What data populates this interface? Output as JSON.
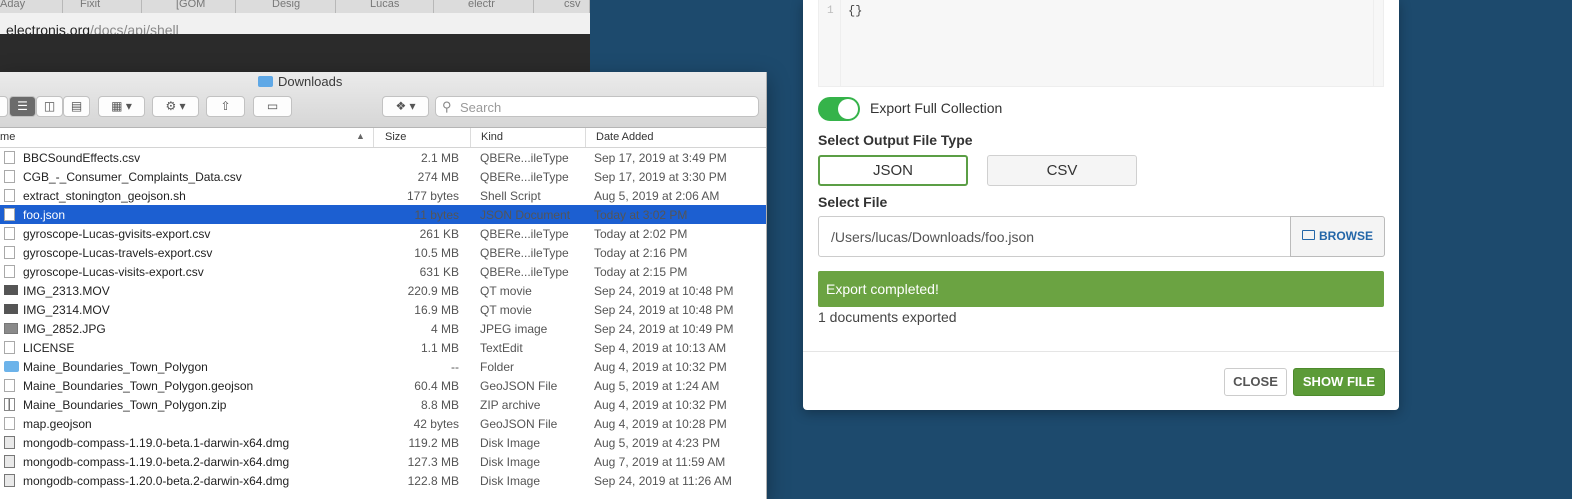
{
  "browser": {
    "tabs": [
      "Aday",
      "Fixit",
      "[GOM",
      "Desig",
      "Lucas",
      "electr",
      "csv"
    ],
    "url_host": "electronjs.org",
    "url_path": "/docs/api/shell"
  },
  "finder": {
    "title": "Downloads",
    "search_placeholder": "Search",
    "columns": {
      "name": "Name",
      "size": "Size",
      "kind": "Kind",
      "date": "Date Added"
    },
    "files": [
      {
        "icon": "document-icon",
        "name": "BBCSoundEffects.csv",
        "size": "2.1 MB",
        "kind": "QBERe...ileType",
        "date": "Sep 17, 2019 at 3:49 PM"
      },
      {
        "icon": "document-icon",
        "name": "CGB_-_Consumer_Complaints_Data.csv",
        "size": "274 MB",
        "kind": "QBERe...ileType",
        "date": "Sep 17, 2019 at 3:30 PM"
      },
      {
        "icon": "document-icon",
        "name": "extract_stonington_geojson.sh",
        "size": "177 bytes",
        "kind": "Shell Script",
        "date": "Aug 5, 2019 at 2:06 AM"
      },
      {
        "icon": "document-icon",
        "name": "foo.json",
        "size": "11 bytes",
        "kind": "JSON Document",
        "date": "Today at 3:02 PM",
        "selected": true
      },
      {
        "icon": "document-icon",
        "name": "gyroscope-Lucas-gvisits-export.csv",
        "size": "261 KB",
        "kind": "QBERe...ileType",
        "date": "Today at 2:02 PM"
      },
      {
        "icon": "document-icon",
        "name": "gyroscope-Lucas-travels-export.csv",
        "size": "10.5 MB",
        "kind": "QBERe...ileType",
        "date": "Today at 2:16 PM"
      },
      {
        "icon": "document-icon",
        "name": "gyroscope-Lucas-visits-export.csv",
        "size": "631 KB",
        "kind": "QBERe...ileType",
        "date": "Today at 2:15 PM"
      },
      {
        "icon": "movie-icon",
        "name": "IMG_2313.MOV",
        "size": "220.9 MB",
        "kind": "QT movie",
        "date": "Sep 24, 2019 at 10:48 PM"
      },
      {
        "icon": "movie-icon",
        "name": "IMG_2314.MOV",
        "size": "16.9 MB",
        "kind": "QT movie",
        "date": "Sep 24, 2019 at 10:48 PM"
      },
      {
        "icon": "image-icon",
        "name": "IMG_2852.JPG",
        "size": "4 MB",
        "kind": "JPEG image",
        "date": "Sep 24, 2019 at 10:49 PM"
      },
      {
        "icon": "document-icon",
        "name": "LICENSE",
        "size": "1.1 MB",
        "kind": "TextEdit",
        "date": "Sep 4, 2019 at 10:13 AM"
      },
      {
        "icon": "folder-icon",
        "name": "Maine_Boundaries_Town_Polygon",
        "size": "--",
        "kind": "Folder",
        "date": "Aug 4, 2019 at 10:32 PM"
      },
      {
        "icon": "document-icon",
        "name": "Maine_Boundaries_Town_Polygon.geojson",
        "size": "60.4 MB",
        "kind": "GeoJSON File",
        "date": "Aug 5, 2019 at 1:24 AM"
      },
      {
        "icon": "zip-icon",
        "name": "Maine_Boundaries_Town_Polygon.zip",
        "size": "8.8 MB",
        "kind": "ZIP archive",
        "date": "Aug 4, 2019 at 10:32 PM"
      },
      {
        "icon": "document-icon",
        "name": "map.geojson",
        "size": "42 bytes",
        "kind": "GeoJSON File",
        "date": "Aug 4, 2019 at 10:28 PM"
      },
      {
        "icon": "disk-image-icon",
        "name": "mongodb-compass-1.19.0-beta.1-darwin-x64.dmg",
        "size": "119.2 MB",
        "kind": "Disk Image",
        "date": "Aug 5, 2019 at 4:23 PM"
      },
      {
        "icon": "disk-image-icon",
        "name": "mongodb-compass-1.19.0-beta.2-darwin-x64.dmg",
        "size": "127.3 MB",
        "kind": "Disk Image",
        "date": "Aug 7, 2019 at 11:59 AM"
      },
      {
        "icon": "disk-image-icon",
        "name": "mongodb-compass-1.20.0-beta.2-darwin-x64.dmg",
        "size": "122.8 MB",
        "kind": "Disk Image",
        "date": "Sep 24, 2019 at 11:26 AM"
      }
    ]
  },
  "modal": {
    "editor_line": "1",
    "editor_code": "{}",
    "toggle_label": "Export Full Collection",
    "toggle_on": true,
    "output_type_label": "Select Output File Type",
    "types": [
      "JSON",
      "CSV"
    ],
    "selected_type": "JSON",
    "select_file_label": "Select File",
    "file_path": "/Users/lucas/Downloads/foo.json",
    "browse_label": "BROWSE",
    "banner": "Export completed!",
    "count_text": "1 documents exported",
    "close_label": "CLOSE",
    "show_file_label": "SHOW FILE",
    "colors": {
      "success": "#6ba342",
      "toggle": "#35b34a",
      "primary_button": "#5c9b38",
      "link": "#2366a8"
    }
  }
}
